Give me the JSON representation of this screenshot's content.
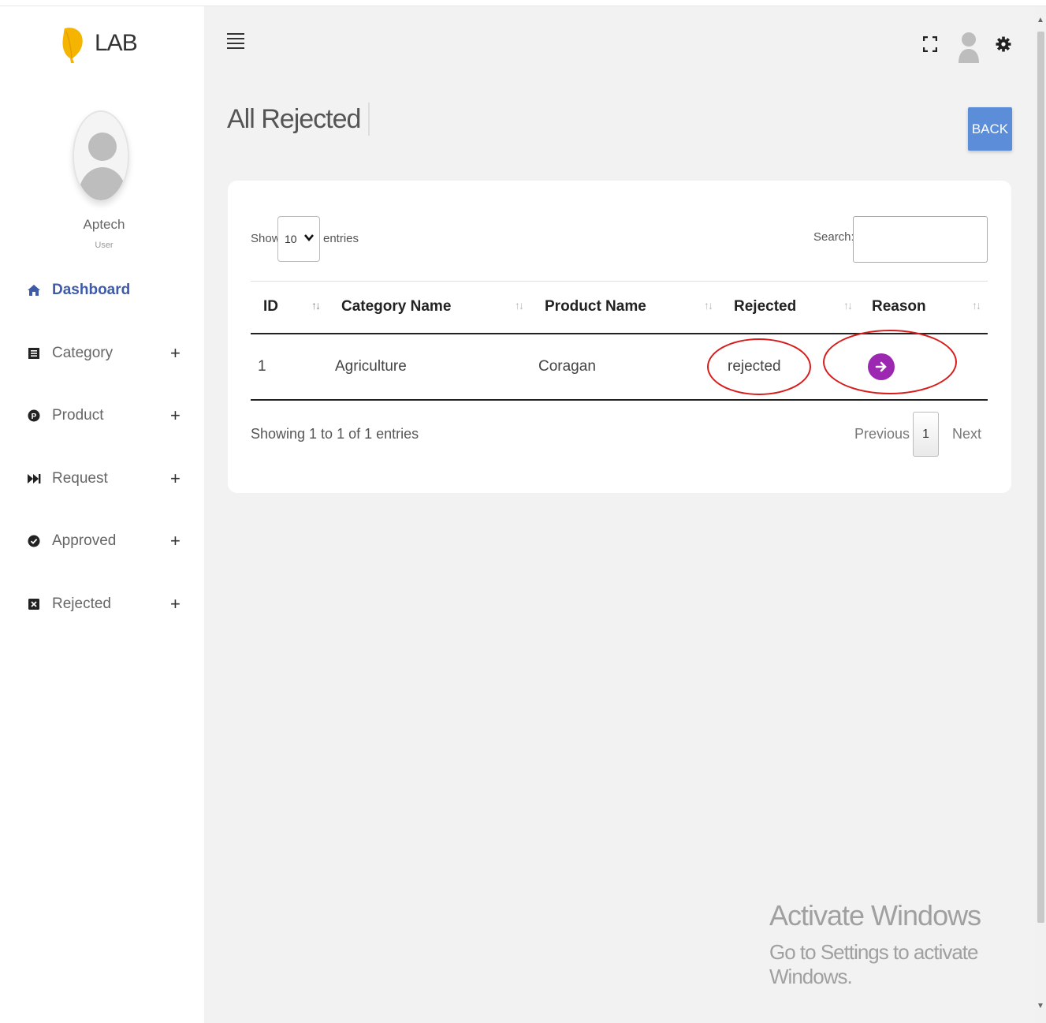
{
  "brand": {
    "name": "LAB"
  },
  "profile": {
    "name": "Aptech",
    "role": "User"
  },
  "sidebar": {
    "items": [
      {
        "label": "Dashboard",
        "icon": "home-icon",
        "active": true
      },
      {
        "label": "Category",
        "icon": "list-icon",
        "expand": "+"
      },
      {
        "label": "Product",
        "icon": "product-icon",
        "expand": "+"
      },
      {
        "label": "Request",
        "icon": "fast-forward-icon",
        "expand": "+"
      },
      {
        "label": "Approved",
        "icon": "check-circle-icon",
        "expand": "+"
      },
      {
        "label": "Rejected",
        "icon": "x-square-icon",
        "expand": "+"
      }
    ]
  },
  "header": {
    "icons": [
      "hamburger-icon",
      "fullscreen-icon",
      "user-icon",
      "gear-icon"
    ]
  },
  "page": {
    "title": "All Rejected",
    "back_label": "BACK"
  },
  "table_controls": {
    "show_label": "Show",
    "length_value": "10",
    "entries_label": "entries",
    "search_label": "Search:",
    "search_value": ""
  },
  "table": {
    "columns": [
      "ID",
      "Category Name",
      "Product Name",
      "Rejected",
      "Reason"
    ],
    "rows": [
      {
        "id": "1",
        "category": "Agriculture",
        "product": "Coragan",
        "rejected": "rejected"
      }
    ]
  },
  "pagination": {
    "info": "Showing 1 to 1 of 1 entries",
    "previous": "Previous",
    "current": "1",
    "next": "Next"
  },
  "watermark": {
    "title": "Activate Windows",
    "subtitle": "Go to Settings to activate Windows."
  },
  "colors": {
    "accent": "#3d5ba9",
    "back_button": "#5b8dd9",
    "reason_button": "#9c27b0",
    "highlight": "#d81b1b",
    "brand_leaf": "#f5b400"
  }
}
